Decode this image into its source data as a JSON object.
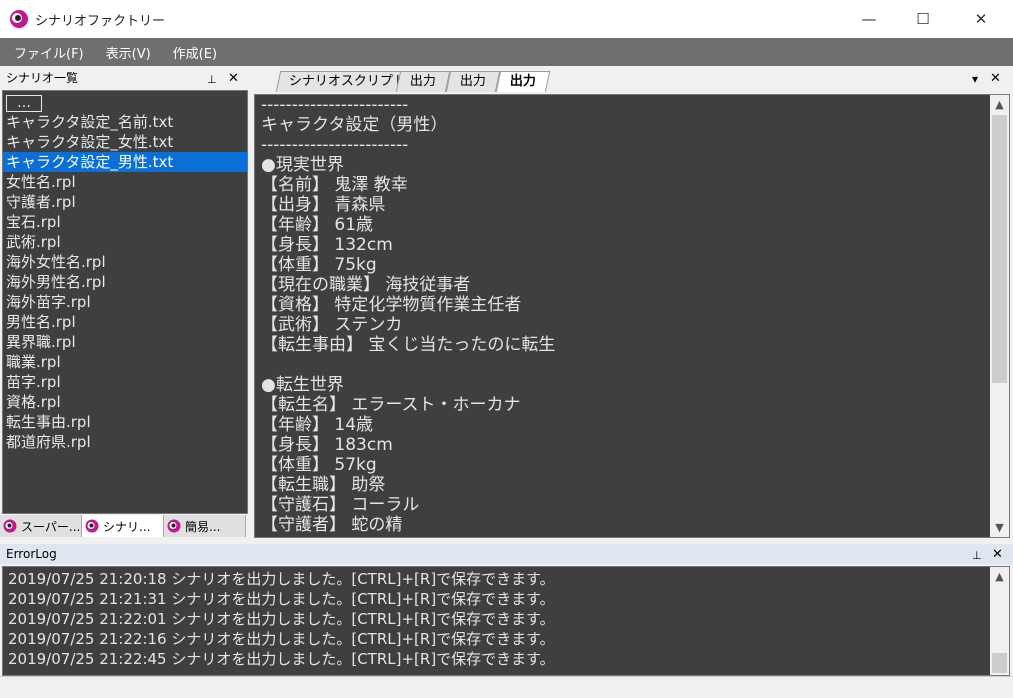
{
  "window": {
    "title": "シナリオファクトリー",
    "minimize": "—",
    "maximize": "☐",
    "close": "✕"
  },
  "menu": [
    "ファイル(F)",
    "表示(V)",
    "作成(E)"
  ],
  "left_panel": {
    "title": "シナリオ一覧",
    "pin": "📌",
    "close": "✕",
    "parent_label": "…",
    "files": [
      "キャラクタ設定_名前.txt",
      "キャラクタ設定_女性.txt",
      "キャラクタ設定_男性.txt",
      "女性名.rpl",
      "守護者.rpl",
      "宝石.rpl",
      "武術.rpl",
      "海外女性名.rpl",
      "海外男性名.rpl",
      "海外苗字.rpl",
      "男性名.rpl",
      "異界職.rpl",
      "職業.rpl",
      "苗字.rpl",
      "資格.rpl",
      "転生事由.rpl",
      "都道府県.rpl"
    ],
    "selected_index": 2,
    "bottom_tabs": [
      "スーパー...",
      "シナリ...",
      "簡易..."
    ],
    "active_bottom_tab": 1
  },
  "right_panel": {
    "tabs": [
      "シナリオスクリプト",
      "出力",
      "出力",
      "出力"
    ],
    "active_tab": 3,
    "dropdown": "▾",
    "close": "✕",
    "lines": [
      "------------------------",
      "キャラクタ設定（男性）",
      "------------------------",
      "●現実世界",
      "【名前】 鬼澤 教幸",
      "【出身】 青森県",
      "【年齢】 61歳",
      "【身長】 132cm",
      "【体重】 75kg",
      "【現在の職業】 海技従事者",
      "【資格】 特定化学物質作業主任者",
      "【武術】 ステンカ",
      "【転生事由】 宝くじ当たったのに転生",
      "",
      "●転生世界",
      "【転生名】 エラースト・ホーカナ",
      "【年齢】 14歳",
      "【身長】 183cm",
      "【体重】 57kg",
      "【転生職】 助祭",
      "【守護石】 コーラル",
      "【守護者】 蛇の精"
    ],
    "scroll_position": 0.0
  },
  "error_log": {
    "title": "ErrorLog",
    "pin": "📌",
    "close": "✕",
    "entries": [
      "2019/07/25 21:20:18 シナリオを出力しました。[CTRL]+[R]で保存できます。",
      "2019/07/25 21:21:31 シナリオを出力しました。[CTRL]+[R]で保存できます。",
      "2019/07/25 21:22:01 シナリオを出力しました。[CTRL]+[R]で保存できます。",
      "2019/07/25 21:22:16 シナリオを出力しました。[CTRL]+[R]で保存できます。",
      "2019/07/25 21:22:45 シナリオを出力しました。[CTRL]+[R]で保存できます。"
    ]
  },
  "colors": {
    "menubar": "#6f6f6f",
    "dark_bg": "#3f3f3f",
    "selection": "#0a6fd6",
    "app_icon": "#c2188f"
  }
}
